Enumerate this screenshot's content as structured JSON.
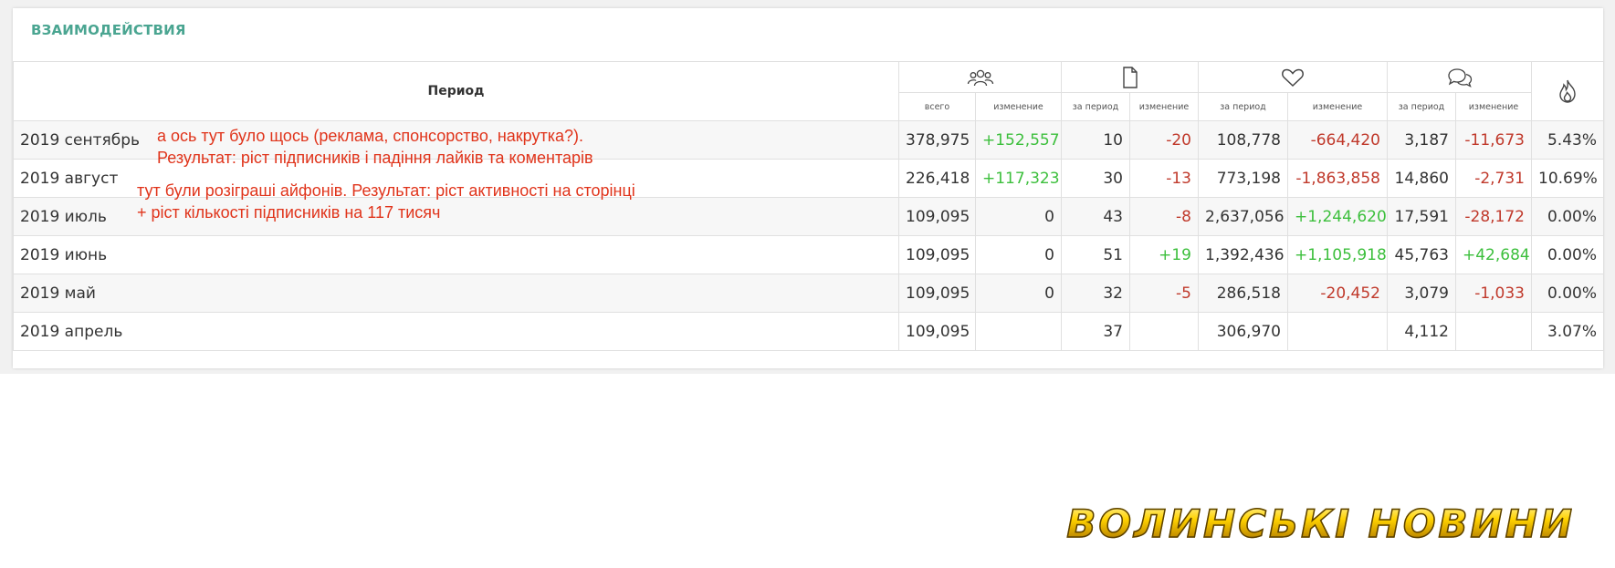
{
  "panel": {
    "title": "ВЗАИМОДЕЙСТВИЯ"
  },
  "table": {
    "period_header": "Период",
    "icons": [
      "followers-icon",
      "posts-icon",
      "likes-icon",
      "comments-icon",
      "engagement-flame-icon"
    ],
    "subheaders": {
      "followers_total": "всего",
      "followers_change": "изменение",
      "posts_period": "за период",
      "posts_change": "изменение",
      "likes_period": "за период",
      "likes_change": "изменение",
      "comments_period": "за период",
      "comments_change": "изменение"
    },
    "rows": [
      {
        "period": "2019 сентябрь",
        "followers_total": "378,975",
        "followers_change": "+152,557",
        "posts": "10",
        "posts_change": "-20",
        "likes": "108,778",
        "likes_change": "-664,420",
        "comments": "3,187",
        "comments_change": "-11,673",
        "rate": "5.43%"
      },
      {
        "period": "2019 август",
        "followers_total": "226,418",
        "followers_change": "+117,323",
        "posts": "30",
        "posts_change": "-13",
        "likes": "773,198",
        "likes_change": "-1,863,858",
        "comments": "14,860",
        "comments_change": "-2,731",
        "rate": "10.69%"
      },
      {
        "period": "2019 июль",
        "followers_total": "109,095",
        "followers_change": "0",
        "posts": "43",
        "posts_change": "-8",
        "likes": "2,637,056",
        "likes_change": "+1,244,620",
        "comments": "17,591",
        "comments_change": "-28,172",
        "rate": "0.00%"
      },
      {
        "period": "2019 июнь",
        "followers_total": "109,095",
        "followers_change": "0",
        "posts": "51",
        "posts_change": "+19",
        "likes": "1,392,436",
        "likes_change": "+1,105,918",
        "comments": "45,763",
        "comments_change": "+42,684",
        "rate": "0.00%"
      },
      {
        "period": "2019 май",
        "followers_total": "109,095",
        "followers_change": "0",
        "posts": "32",
        "posts_change": "-5",
        "likes": "286,518",
        "likes_change": "-20,452",
        "comments": "3,079",
        "comments_change": "-1,033",
        "rate": "0.00%"
      },
      {
        "period": "2019 апрель",
        "followers_total": "109,095",
        "followers_change": "",
        "posts": "37",
        "posts_change": "",
        "likes": "306,970",
        "likes_change": "",
        "comments": "4,112",
        "comments_change": "",
        "rate": "3.07%"
      }
    ]
  },
  "annotations": {
    "note1_line1": "а ось тут було щось (реклама, спонсорство, накрутка?).",
    "note1_line2": "Результат: ріст підписників і падіння лайків та коментарів",
    "note2_line1": "тут були розіграші айфонів. Результат: ріст активності на сторінці",
    "note2_line2": "+ ріст кількості підписників на 117 тисяч"
  },
  "watermark": "ВОЛИНСЬКІ НОВИНИ",
  "colors": {
    "title_accent": "#4aa591",
    "positive": "#3cbf3c",
    "negative": "#c0392b",
    "annotation": "#e0341b",
    "watermark_gold": "#ffd200"
  }
}
